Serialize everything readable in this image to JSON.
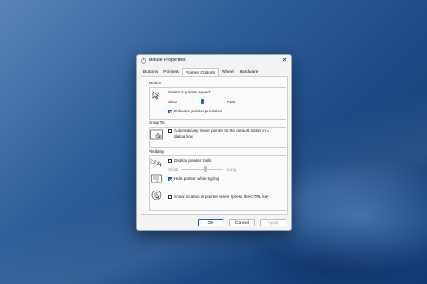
{
  "window": {
    "title": "Mouse Properties",
    "close_label": "✕"
  },
  "tabs": [
    "Buttons",
    "Pointers",
    "Pointer Options",
    "Wheel",
    "Hardware"
  ],
  "active_tab": "Pointer Options",
  "motion": {
    "heading": "Motion",
    "speed_label": "Select a pointer speed:",
    "slow_label": "Slow",
    "fast_label": "Fast",
    "speed_level": 0.5,
    "precision_label": "Enhance pointer precision",
    "precision_checked": true
  },
  "snap_to": {
    "heading": "Snap To",
    "option_line1": "Automatically move pointer to the default button in a",
    "option_line2": "dialog box",
    "checked": false
  },
  "visibility": {
    "heading": "Visibility",
    "trails_label": "Display pointer trails",
    "trails_checked": false,
    "short_label": "Short",
    "long_label": "Long",
    "hide_label": "Hide pointer while typing",
    "hide_checked": true,
    "ctrl_label": "Show location of pointer when I press the CTRL key",
    "ctrl_checked": false
  },
  "buttons": {
    "ok": "OK",
    "cancel": "Cancel",
    "apply": "Apply"
  },
  "colors": {
    "accent": "#1f5fbf",
    "desktop": "#1d4a86"
  }
}
